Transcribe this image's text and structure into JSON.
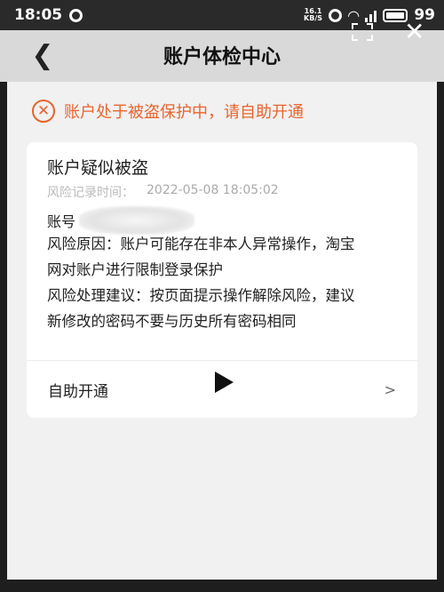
{
  "status_bar": {
    "time": "18:05",
    "net_speed_value": "16.1",
    "net_speed_unit": "KB/S",
    "battery": "99"
  },
  "header": {
    "title": "账户体检中心",
    "back_icon": "chevron-left-icon"
  },
  "alert": {
    "text": "账户处于被盗保护中，请自助开通",
    "color": "#e8642d"
  },
  "card": {
    "title": "账户疑似被盗",
    "risk_time_label": "风险记录时间：",
    "risk_time_value": "2022-05-08 18:05:02",
    "account_label": "账号",
    "description_line1": "风险原因：账户可能存在非本人异常操作，淘宝",
    "description_line2": "网对账户进行限制登录保护",
    "suggestion_line1": "风险处理建议：按页面提示操作解除风险，建议",
    "suggestion_line2": "新修改的密码不要与历史所有密码相同",
    "action_label": "自助开通",
    "action_chevron": ">"
  }
}
